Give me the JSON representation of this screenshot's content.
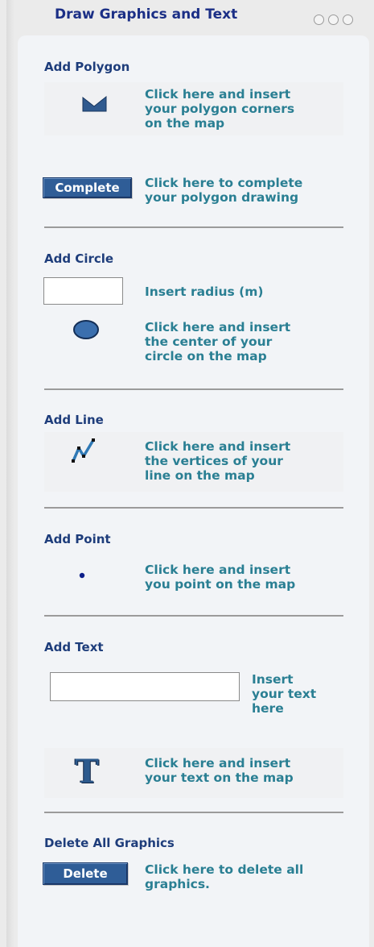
{
  "header": {
    "title": "Draw Graphics and Text"
  },
  "sections": {
    "polygon": {
      "title": "Add Polygon",
      "draw_hint": "Click here and insert\nyour polygon corners\non the map",
      "complete_label": "Complete",
      "complete_hint": "Click here to complete\nyour polygon drawing"
    },
    "circle": {
      "title": "Add Circle",
      "radius_value": "",
      "radius_hint": "Insert radius (m)",
      "draw_hint": "Click here and insert\nthe center of your\ncircle on the map"
    },
    "line": {
      "title": "Add Line",
      "draw_hint": "Click here and insert\nthe vertices of your\nline on the map"
    },
    "point": {
      "title": "Add Point",
      "draw_hint": "Click here and insert\nyou point on the map"
    },
    "text": {
      "title": "Add Text",
      "text_value": "",
      "text_hint": "Insert\nyour text\nhere",
      "draw_hint": "Click here and insert\nyour text on the map",
      "icon_glyph": "T"
    },
    "delete": {
      "title": "Delete All Graphics",
      "delete_label": "Delete",
      "delete_hint": "Click here to delete all\ngraphics."
    }
  },
  "colors": {
    "header_title": "#1b2f86",
    "section_title": "#1e3d7b",
    "hint_text": "#2a7f93",
    "button_bg": "#2f5d97",
    "panel_bg": "#f2f4f7"
  },
  "icons": {
    "panel_controls": "window-dots-icon",
    "polygon": "polygon-icon",
    "circle": "circle-icon",
    "line": "line-icon",
    "point": "point-icon",
    "text": "text-icon"
  }
}
